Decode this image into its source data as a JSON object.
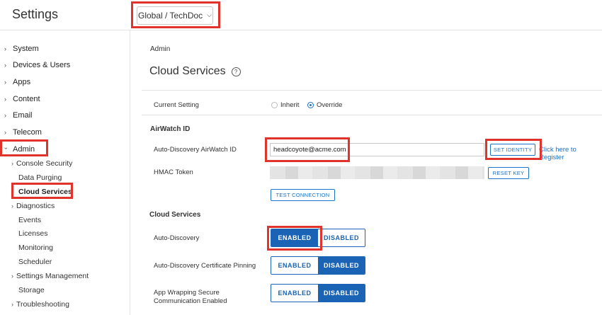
{
  "header": {
    "app_title": "Settings",
    "org_selector": "Global / TechDoc",
    "org_selector_icon": "chevron-down-icon"
  },
  "sidebar": {
    "top_items": [
      {
        "label": "System",
        "expanded": false
      },
      {
        "label": "Devices & Users",
        "expanded": false
      },
      {
        "label": "Apps",
        "expanded": false
      },
      {
        "label": "Content",
        "expanded": false
      },
      {
        "label": "Email",
        "expanded": false
      },
      {
        "label": "Telecom",
        "expanded": false
      },
      {
        "label": "Admin",
        "expanded": true
      }
    ],
    "admin_children": [
      {
        "label": "Console Security",
        "has_children": true
      },
      {
        "label": "Data Purging",
        "has_children": false
      },
      {
        "label": "Cloud Services",
        "has_children": false,
        "selected": true
      },
      {
        "label": "Diagnostics",
        "has_children": true
      },
      {
        "label": "Events",
        "has_children": false
      },
      {
        "label": "Licenses",
        "has_children": false
      },
      {
        "label": "Monitoring",
        "has_children": false
      },
      {
        "label": "Scheduler",
        "has_children": false
      },
      {
        "label": "Settings Management",
        "has_children": true
      },
      {
        "label": "Storage",
        "has_children": false
      },
      {
        "label": "Troubleshooting",
        "has_children": true
      }
    ]
  },
  "main": {
    "breadcrumb": "Admin",
    "title": "Cloud Services",
    "current_setting": {
      "label": "Current Setting",
      "options": [
        "Inherit",
        "Override"
      ],
      "selected": "Override"
    },
    "airwatch_section": {
      "heading": "AirWatch ID",
      "auto_discovery_label": "Auto-Discovery AirWatch ID",
      "auto_discovery_value": "headcoyote@acme.com",
      "set_identity_button": "SET IDENTITY",
      "register_link": "Click here to Register",
      "hmac_label": "HMAC Token",
      "reset_key_button": "RESET KEY",
      "test_connection_button": "TEST CONNECTION"
    },
    "cloud_section": {
      "heading": "Cloud Services",
      "rows": [
        {
          "label": "Auto-Discovery",
          "enabled_label": "ENABLED",
          "disabled_label": "DISABLED",
          "state": "enabled"
        },
        {
          "label": "Auto-Discovery Certificate Pinning",
          "enabled_label": "ENABLED",
          "disabled_label": "DISABLED",
          "state": "disabled"
        },
        {
          "label": "App Wrapping Secure Communication Enabled",
          "enabled_label": "ENABLED",
          "disabled_label": "DISABLED",
          "state": "disabled"
        }
      ]
    }
  },
  "colors": {
    "accent": "#1a63b5",
    "highlight_box": "#e0332c"
  }
}
